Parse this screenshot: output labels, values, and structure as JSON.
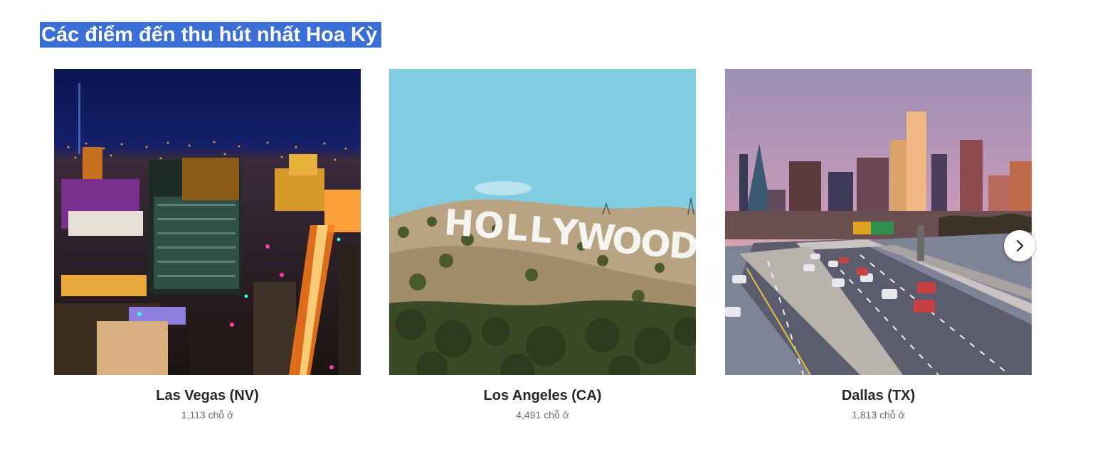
{
  "section": {
    "title": "Các điểm đến thu hút nhất Hoa Kỳ"
  },
  "colors": {
    "title_background": "#3a6fd8",
    "title_text": "#ffffff",
    "card_title": "#262626",
    "card_count": "#6b6b6b"
  },
  "destinations": [
    {
      "name": "Las Vegas (NV)",
      "count": "1,113 chỗ ở",
      "image_icon": "las-vegas-night-skyline-photo"
    },
    {
      "name": "Los Angeles (CA)",
      "count": "4,491 chỗ ở",
      "image_icon": "hollywood-sign-photo"
    },
    {
      "name": "Dallas (TX)",
      "count": "1,813 chỗ ở",
      "image_icon": "dallas-skyline-highway-photo"
    }
  ],
  "carousel": {
    "next_icon": "chevron-right-icon"
  }
}
